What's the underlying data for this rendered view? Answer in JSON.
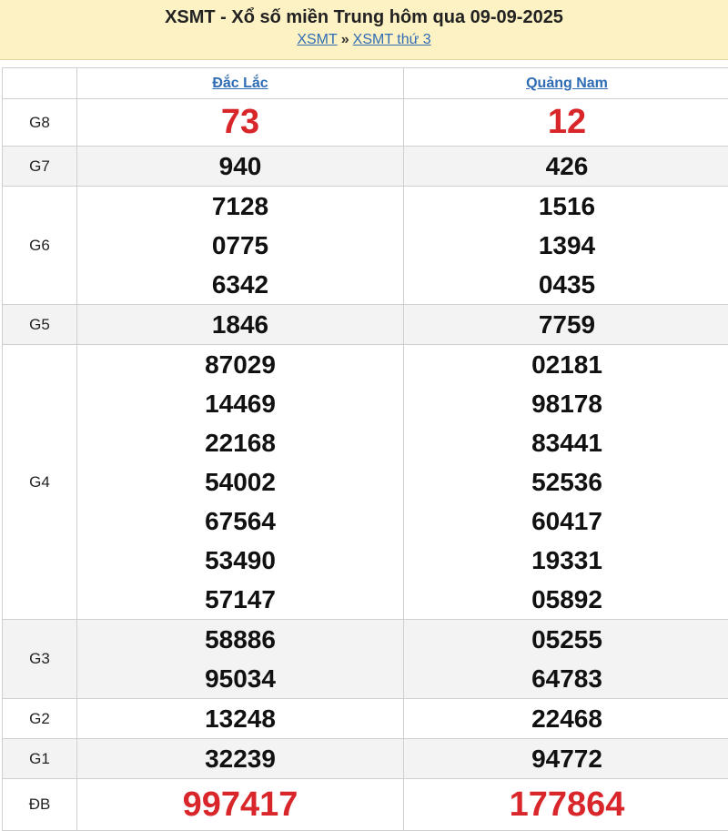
{
  "header": {
    "title": "XSMT - Xổ số miền Trung hôm qua 09-09-2025",
    "breadcrumb": {
      "link1": "XSMT",
      "separator": "»",
      "link2": "XSMT thứ 3"
    }
  },
  "provinces": [
    "Đắc Lắc",
    "Quảng Nam"
  ],
  "rows": [
    {
      "label": "G8",
      "p1": [
        "73"
      ],
      "p2": [
        "12"
      ]
    },
    {
      "label": "G7",
      "p1": [
        "940"
      ],
      "p2": [
        "426"
      ]
    },
    {
      "label": "G6",
      "p1": [
        "7128",
        "0775",
        "6342"
      ],
      "p2": [
        "1516",
        "1394",
        "0435"
      ]
    },
    {
      "label": "G5",
      "p1": [
        "1846"
      ],
      "p2": [
        "7759"
      ]
    },
    {
      "label": "G4",
      "p1": [
        "87029",
        "14469",
        "22168",
        "54002",
        "67564",
        "53490",
        "57147"
      ],
      "p2": [
        "02181",
        "98178",
        "83441",
        "52536",
        "60417",
        "19331",
        "05892"
      ]
    },
    {
      "label": "G3",
      "p1": [
        "58886",
        "95034"
      ],
      "p2": [
        "05255",
        "64783"
      ]
    },
    {
      "label": "G2",
      "p1": [
        "13248"
      ],
      "p2": [
        "22468"
      ]
    },
    {
      "label": "G1",
      "p1": [
        "32239"
      ],
      "p2": [
        "94772"
      ]
    },
    {
      "label": "ĐB",
      "p1": [
        "997417"
      ],
      "p2": [
        "177864"
      ]
    }
  ],
  "colors": {
    "header_bg": "#fdf2c4",
    "link": "#2f6cb3",
    "highlight": "#d9262b",
    "alt_row": "#f3f3f3"
  }
}
